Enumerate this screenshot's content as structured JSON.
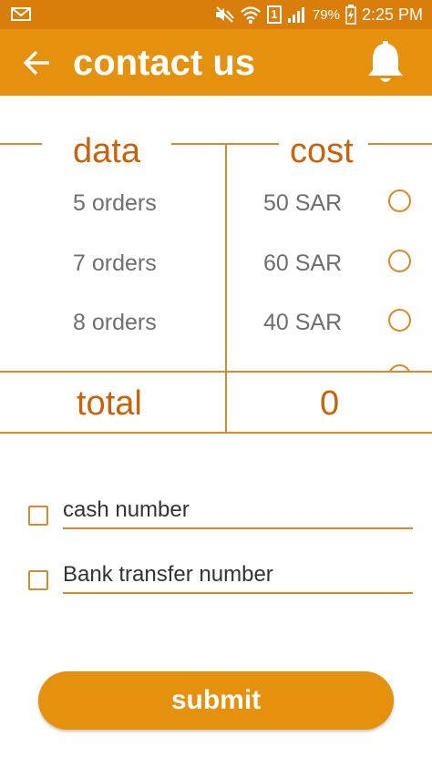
{
  "status_bar": {
    "battery": "79%",
    "time": "2:25 PM",
    "sim_badge": "1"
  },
  "app_bar": {
    "title": "contact us",
    "back_icon": "arrow-left-icon",
    "notification_icon": "bell-icon"
  },
  "table": {
    "headers": {
      "data": "data",
      "cost": "cost"
    },
    "rows": [
      {
        "data": "5 orders",
        "cost": "50 SAR"
      },
      {
        "data": "7 orders",
        "cost": "60 SAR"
      },
      {
        "data": "8 orders",
        "cost": "40 SAR"
      }
    ],
    "total_label": "total",
    "total_value": "0"
  },
  "form": {
    "cash_placeholder": "cash number",
    "bank_placeholder": "Bank transfer number"
  },
  "submit_label": "submit",
  "colors": {
    "status_bar": "#d97e0a",
    "app_bar": "#e5910d",
    "accent": "#d98a2b",
    "header_text": "#c9620a"
  }
}
